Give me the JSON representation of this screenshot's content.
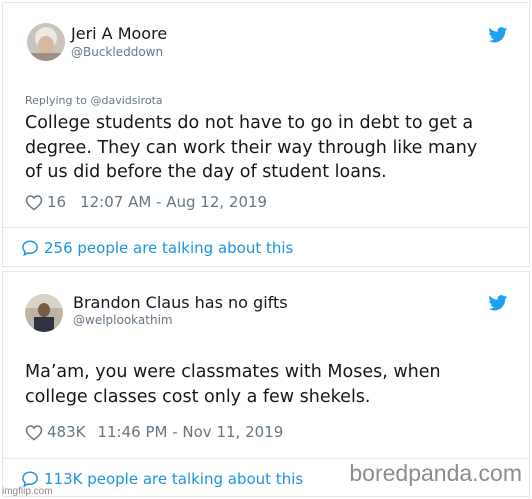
{
  "tweets": [
    {
      "display_name": "Jeri A Moore",
      "handle": "@Buckleddown",
      "replying_to": "Replying to @davidsirota",
      "text_lines": [
        "College students do not have to go in debt to get a",
        "degree. They can work their way through like many",
        "of us did before the day of student loans."
      ],
      "likes": "16",
      "timestamp": "12:07 AM - Aug 12, 2019",
      "talking": "256 people are talking about this"
    },
    {
      "display_name": "Brandon Claus has no gifts",
      "handle": "@welplookathim",
      "text_lines": [
        "Ma’am, you were classmates with Moses, when",
        "college classes cost only a few shekels."
      ],
      "likes": "483K",
      "timestamp": "11:46 PM - Nov 11, 2019",
      "talking": "113K people are talking about this"
    }
  ],
  "watermark": "boredpanda.com",
  "imgflip": "imgflip.com",
  "colors": {
    "twitter_blue": "#1da1f2",
    "link_blue": "#1b95e0",
    "secondary_text": "#657786",
    "border": "#e1e8ed"
  },
  "icons": [
    "twitter-bird-icon",
    "heart-icon",
    "speech-bubble-icon"
  ]
}
